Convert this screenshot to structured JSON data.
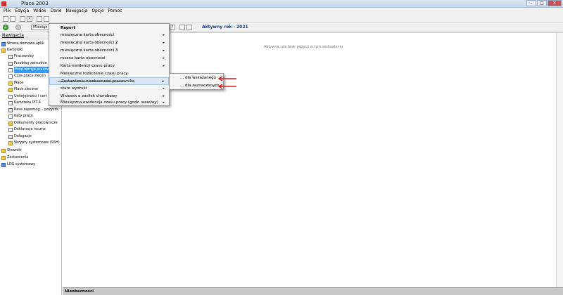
{
  "window": {
    "title": "Płace 2003"
  },
  "menubar": [
    "Plik",
    "Edycja",
    "Widok",
    "Dane",
    "Nawigacja",
    "Opcje",
    "Pomoc"
  ],
  "toolbar": {
    "combo_value": "Miesiąc",
    "year_label": "Aktywny rok - 2021"
  },
  "nav": {
    "header": "Nawigacja",
    "items": [
      "Strona domowa aplik",
      "Kartoteki",
      "Pracownicy",
      "Przebieg zatrudnie",
      "Ewid.wersje pracow",
      "Czas pracy zlecen",
      "Płace",
      "Płace zlecone",
      "Umiejętności i cert",
      "Kartoteka PIT-4",
      "Kasa zapomog. - pożyczk",
      "Kąty pracy",
      "Dokumenty pracownicze",
      "Deklaracje roczne",
      "Delegacje",
      "Skrypty systemowe (SSH)",
      "Słowniki",
      "Zestawienia",
      "LOG systemowy"
    ]
  },
  "menu": {
    "items": [
      "Raport",
      "miesięczna karta obecności",
      "miesięczna karta obecności 2",
      "miesięczna karta obecności 3",
      "roczna karta obecności",
      "Karta ewidencji czasu pracy",
      "Miesięczne rozliczenie czasu pracy",
      "Zestawienie nieobecności pracownika",
      "stare wydruki",
      "Wniosek o zasiłek chorobowy",
      "Miesięczna ewidencja czasu pracy (godz. wew/wy)"
    ],
    "submenu": [
      "... dla wskazanego",
      "... dla zaznaczonych"
    ]
  },
  "content": {
    "empty_message": "Aktywna, ale brak pozycji w tym zestawieniu"
  },
  "status": {
    "panel_label": "Nieobecności"
  },
  "colors": {
    "annotation_red": "#d31b1b",
    "selection_blue": "#3399ff"
  }
}
